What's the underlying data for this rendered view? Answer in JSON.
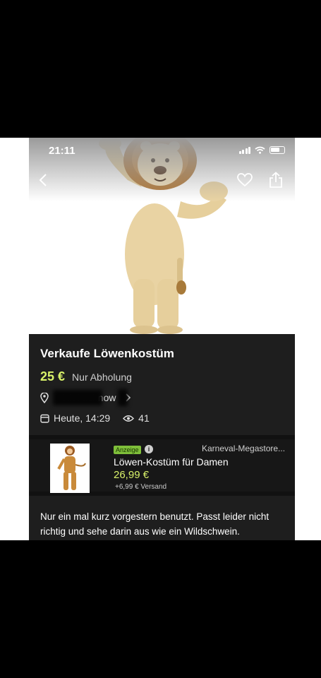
{
  "status_bar": {
    "time": "21:11"
  },
  "listing": {
    "title": "Verkaufe Löwenkostüm",
    "price": "25 €",
    "delivery": "Nur Abholung",
    "location": "Klei   achnow",
    "date": "Heute, 14:29",
    "views": "41"
  },
  "ad": {
    "badge": "Anzeige",
    "info": "i",
    "seller": "Karneval-Megastore...",
    "title": "Löwen-Kostüm für Damen",
    "price": "26,99 €",
    "shipping": "+6,99 € Versand"
  },
  "description": "Nur ein mal kurz vorgestern benutzt. Passt leider nicht richtig und sehe darin aus wie ein Wildschwein.",
  "colors": {
    "price_accent": "#d9f26a",
    "background_dark": "#1e1e1e",
    "ad_badge": "#7fbf3a"
  },
  "icons": [
    "back-icon",
    "heart-icon",
    "share-icon",
    "location-pin-icon",
    "chevron-right-icon",
    "calendar-icon",
    "eye-icon",
    "info-icon"
  ]
}
